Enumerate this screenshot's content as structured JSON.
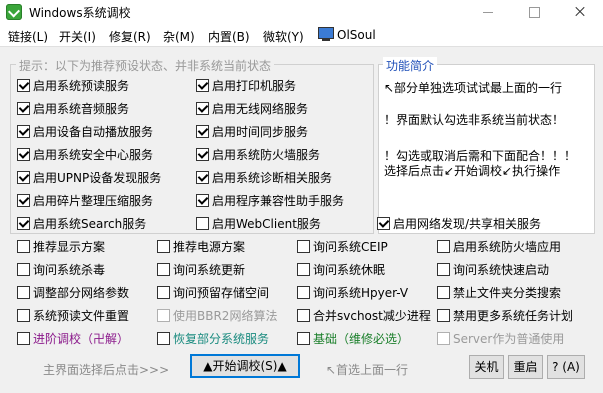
{
  "window": {
    "title": "Windows系统调校"
  },
  "menu": [
    "链接(L)",
    "开关(I)",
    "修复(R)",
    "杂(M)",
    "内置(B)",
    "微软(Y)",
    "OlSoul"
  ],
  "hint_legend": "提示：以下为推荐预设状态、并非系统当前状态",
  "func_panel": {
    "title": "功能简介",
    "lines": [
      "↖部分单独选项试试最上面的一行",
      "！界面默认勾选非系统当前状态！",
      "！勾选或取消后需和下面配合！！！",
      "选择后点击↙开始调校↙执行操作"
    ]
  },
  "checkboxes": [
    {
      "label": "启用系统预读服务",
      "checked": true
    },
    {
      "label": "启用打印机服务",
      "checked": true
    },
    {
      "label": "启用系统音频服务",
      "checked": true
    },
    {
      "label": "启用无线网络服务",
      "checked": true
    },
    {
      "label": "启用设备自动播放服务",
      "checked": true
    },
    {
      "label": "启用时间同步服务",
      "checked": true
    },
    {
      "label": "启用系统安全中心服务",
      "checked": true
    },
    {
      "label": "启用系统防火墙服务",
      "checked": true
    },
    {
      "label": "启用UPNP设备发现服务",
      "checked": true
    },
    {
      "label": "启用系统诊断相关服务",
      "checked": true
    },
    {
      "label": "启用碎片整理压缩服务",
      "checked": true
    },
    {
      "label": "启用程序兼容性助手服务",
      "checked": true
    },
    {
      "label": "启用系统Search服务",
      "checked": true
    },
    {
      "label": "启用WebClient服务",
      "checked": false
    },
    {
      "label": "启用网络发现/共享相关服务",
      "checked": true
    },
    {
      "label": "推荐显示方案",
      "checked": false
    },
    {
      "label": "推荐电源方案",
      "checked": false
    },
    {
      "label": "询问系统CEIP",
      "checked": false
    },
    {
      "label": "启用系统防火墙应用",
      "checked": false
    },
    {
      "label": "询问系统杀毒",
      "checked": false
    },
    {
      "label": "询问系统更新",
      "checked": false
    },
    {
      "label": "询问系统休眠",
      "checked": false
    },
    {
      "label": "询问系统快速启动",
      "checked": false
    },
    {
      "label": "调整部分网络参数",
      "checked": false
    },
    {
      "label": "询问预留存储空间",
      "checked": false
    },
    {
      "label": "询问系统Hpyer-V",
      "checked": false
    },
    {
      "label": "禁止文件夹分类搜索",
      "checked": false
    },
    {
      "label": "系统预读文件重置",
      "checked": false
    },
    {
      "label": "使用BBR2网络算法",
      "checked": false,
      "disabled": true
    },
    {
      "label": "合并svchost减少进程",
      "checked": false
    },
    {
      "label": "禁用更多系统任务计划",
      "checked": false
    },
    {
      "label": "进阶调校（卍解）",
      "checked": false,
      "style": "purple"
    },
    {
      "label": "恢复部分系统服务",
      "checked": false,
      "style": "teal"
    },
    {
      "label": "基础（维修必选）",
      "checked": false,
      "style": "green"
    },
    {
      "label": "Server作为普通使用",
      "checked": false,
      "disabled": true
    }
  ],
  "status_left": "主界面选择后点击>>>",
  "status_mid": "↖首选上面一行",
  "buttons": {
    "start": "▲开始调校(S)▲",
    "shutdown": "关机",
    "restart": "重启",
    "help": "? (A)"
  },
  "colors": {
    "accent": "#0078d7",
    "purple": "#8b1a8b",
    "teal": "#1a8b7f",
    "green": "#1a7f2a"
  }
}
